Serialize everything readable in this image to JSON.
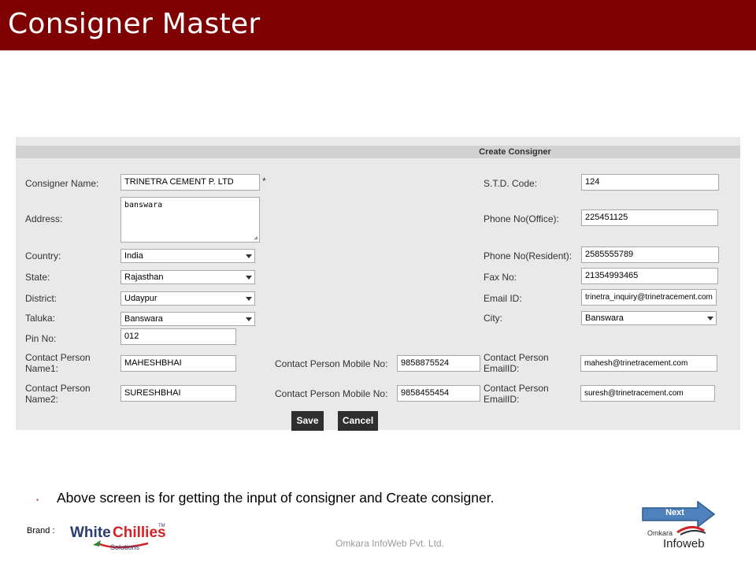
{
  "slide": {
    "title": "Consigner Master",
    "bullet": "Above screen is for getting the input of consigner and Create consigner.",
    "next_label": "Next",
    "brand_label": "Brand :",
    "brand_logo_text": "WhiteChillies Solutions",
    "footer": "Omkara InfoWeb Pvt. Ltd.",
    "company_logo_text": "Omkara Infoweb"
  },
  "form": {
    "header": "Create Consigner",
    "consigner_name": {
      "label": "Consigner Name:",
      "value": "TRINETRA CEMENT P. LTD",
      "required_mark": "*"
    },
    "address": {
      "label": "Address:",
      "value": "banswara"
    },
    "country": {
      "label": "Country:",
      "value": "India"
    },
    "state": {
      "label": "State:",
      "value": "Rajasthan"
    },
    "district": {
      "label": "District:",
      "value": "Udaypur"
    },
    "taluka": {
      "label": "Taluka:",
      "value": "Banswara"
    },
    "pin": {
      "label": "Pin No:",
      "value": "012"
    },
    "contact1": {
      "name_label_line1": "Contact Person",
      "name_label_line2": "Name1:",
      "name": "MAHESHBHAI",
      "mobile_label": "Contact Person Mobile No:",
      "mobile": "9858875524",
      "email_label_line1": "Contact Person",
      "email_label_line2": "EmailID:",
      "email": "mahesh@trinetracement.com"
    },
    "contact2": {
      "name_label_line1": "Contact Person",
      "name_label_line2": "Name2:",
      "name": "SURESHBHAI",
      "mobile_label": "Contact Person Mobile No:",
      "mobile": "9858455454",
      "email_label_line1": "Contact Person",
      "email_label_line2": "EmailID:",
      "email": "suresh@trinetracement.com"
    },
    "std_code": {
      "label": "S.T.D. Code:",
      "value": "124"
    },
    "phone_office": {
      "label": "Phone No(Office):",
      "value": "225451125"
    },
    "phone_resident": {
      "label": "Phone No(Resident):",
      "value": "2585555789"
    },
    "fax": {
      "label": "Fax No:",
      "value": "21354993465"
    },
    "email": {
      "label": "Email ID:",
      "value": "trinetra_inquiry@trinetracement.com"
    },
    "city": {
      "label": "City:",
      "value": "Banswara"
    },
    "save_label": "Save",
    "cancel_label": "Cancel"
  },
  "colors": {
    "title_bar": "#7f0000",
    "button": "#2f2f2f",
    "next_arrow": "#4f81bd"
  }
}
